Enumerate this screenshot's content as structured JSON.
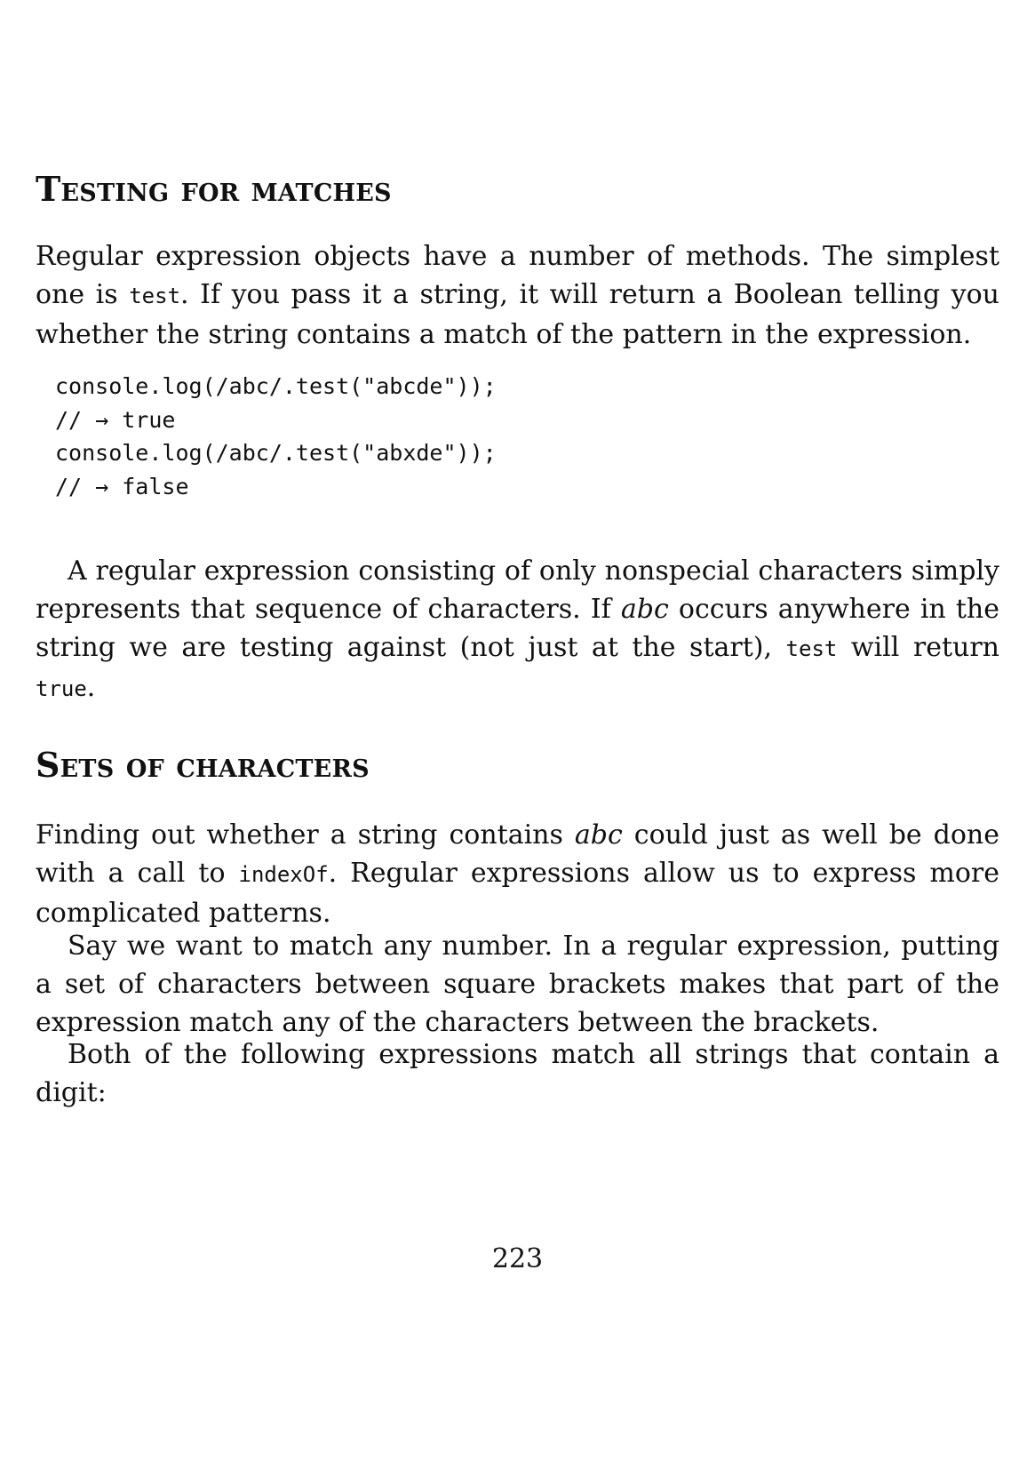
{
  "section1": {
    "heading": "Testing for matches",
    "para1": {
      "t1": "Regular expression objects have a number of methods. The simplest one is ",
      "code1": "test",
      "t2": ". If you pass it a string, it will return a Boolean telling you whether the string contains a match of the pattern in the expression."
    },
    "code_lines": [
      "console.log(/abc/.test(\"abcde\"));",
      "// → true",
      "console.log(/abc/.test(\"abxde\"));",
      "// → false"
    ],
    "para2": {
      "t1": "A regular expression consisting of only nonspecial characters simply represents that sequence of characters. If ",
      "em1": "abc",
      "t2": " occurs anywhere in the string we are testing against (not just at the start), ",
      "code1": "test",
      "t3": " will return ",
      "code2": "true",
      "t4": "."
    }
  },
  "section2": {
    "heading": "Sets of characters",
    "para1": {
      "t1": "Finding out whether a string contains ",
      "em1": "abc",
      "t2": " could just as well be done with a call to ",
      "code1": "indexOf",
      "t3": ". Regular expressions allow us to express more complicated patterns."
    },
    "para2": "Say we want to match any number. In a regular expression, putting a set of characters between square brackets makes that part of the expression match any of the characters between the brackets.",
    "para3": "Both of the following expressions match all strings that contain a digit:"
  },
  "page_number": "223"
}
